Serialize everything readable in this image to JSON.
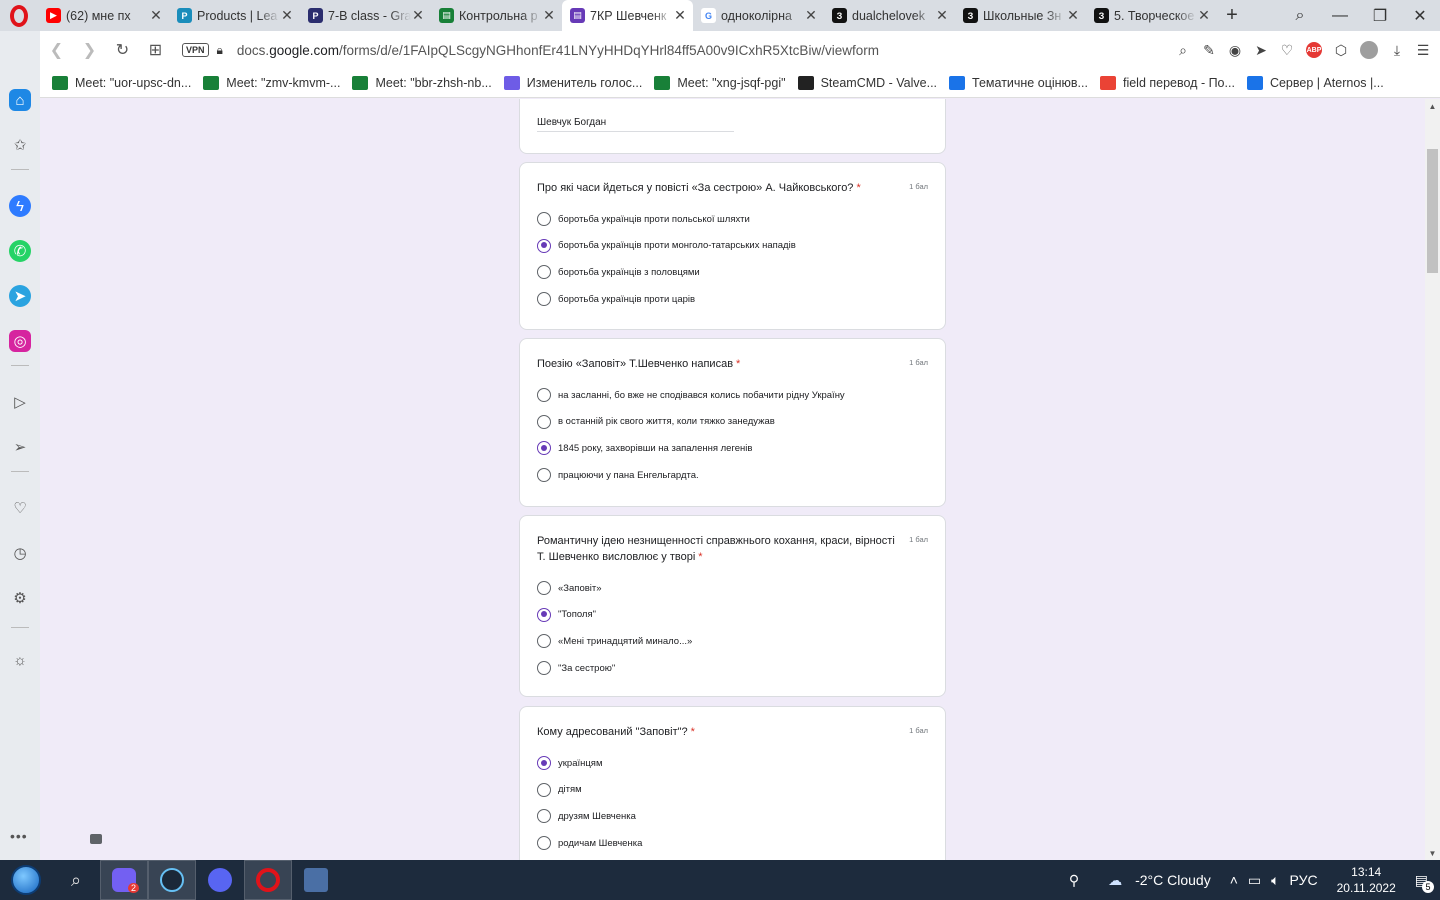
{
  "tabs": [
    {
      "title": "(62) мне пх",
      "color": "#ff0000",
      "glyph": "▶",
      "active": false
    },
    {
      "title": "Products | Lea",
      "color": "#1a8dbb",
      "glyph": "P",
      "active": false
    },
    {
      "title": "7-B class - Gra",
      "color": "#2b2d6e",
      "glyph": "P",
      "active": false
    },
    {
      "title": "Контрольна р",
      "color": "#188038",
      "glyph": "▤",
      "active": false
    },
    {
      "title": "7КР Шевченк",
      "color": "#673ab7",
      "glyph": "▤",
      "active": true
    },
    {
      "title": "одноколірна",
      "color": "#ffffff",
      "glyph": "G",
      "active": false
    },
    {
      "title": "dualchelovek",
      "color": "#111111",
      "glyph": "З",
      "active": false
    },
    {
      "title": "Школьные Зн",
      "color": "#111111",
      "glyph": "З",
      "active": false
    },
    {
      "title": "5. Творческое",
      "color": "#111111",
      "glyph": "З",
      "active": false
    }
  ],
  "address": {
    "vpn": "VPN",
    "url_prefix": "docs.",
    "url_domain": "google.com",
    "url_path": "/forms/d/e/1FAIpQLScgyNGHhonfEr41LNYyHHDqYHrl84ff5A00v9ICxhR5XtcBiw/viewform"
  },
  "bookmarks": [
    {
      "label": "Meet: \"uor-upsc-dn...",
      "color": "#188038"
    },
    {
      "label": "Meet: \"zmv-kmvm-...",
      "color": "#188038"
    },
    {
      "label": "Meet: \"bbr-zhsh-nb...",
      "color": "#188038"
    },
    {
      "label": "Изменитель голос...",
      "color": "#6e5ce6"
    },
    {
      "label": "Meet: \"xng-jsqf-pgi\"",
      "color": "#188038"
    },
    {
      "label": "SteamCMD - Valve...",
      "color": "#222222"
    },
    {
      "label": "Тематичне оцінюв...",
      "color": "#1a73e8"
    },
    {
      "label": "field перевод - По...",
      "color": "#ea4335"
    },
    {
      "label": "Сервер | Aternos |...",
      "color": "#1a73e8"
    }
  ],
  "form": {
    "name_value": "Шевчук Богдан",
    "questions": [
      {
        "title": "Про які часи йдеться у повісті «За сестрою» А. Чайковського?",
        "points": "1 бал",
        "options": [
          "боротьба українців проти польської шляхти",
          "боротьба українців проти монголо-татарських нападів",
          "боротьба українців з половцями",
          "боротьба українців проти царів"
        ]
      },
      {
        "title": "Поезію «Заповіт» Т.Шевченко написав",
        "points": "1 бал",
        "options": [
          "на засланні, бо вже не сподівався колись побачити рідну Україну",
          "в останній рік свого життя, коли тяжко занедужав",
          "1845 року, захворівши на запалення легенів",
          "працюючи у пана Енгельгардта."
        ]
      },
      {
        "title": "Романтичну ідею незнищенності справжнього кохання, краси, вірності Т. Шевченко висловлює у творі",
        "points": "1 бал",
        "options": [
          "«Заповіт»",
          "\"Тополя\"",
          "«Мені тринадцятий минало...»",
          "\"За сестрою\""
        ]
      },
      {
        "title": "Кому адресований \"Заповіт\"?",
        "points": "1 бал",
        "options": [
          "українцям",
          "дітям",
          "друзям Шевченка",
          "родичам Шевченка"
        ]
      }
    ],
    "selected": [
      1,
      2,
      1,
      0
    ],
    "required_mark": "*"
  },
  "taskbar": {
    "weather": "-2°C  Cloudy",
    "lang": "РУС",
    "time": "13:14",
    "date": "20.11.2022",
    "notif_count": "5",
    "viber_badge": "2"
  },
  "accent": "#673ab7"
}
